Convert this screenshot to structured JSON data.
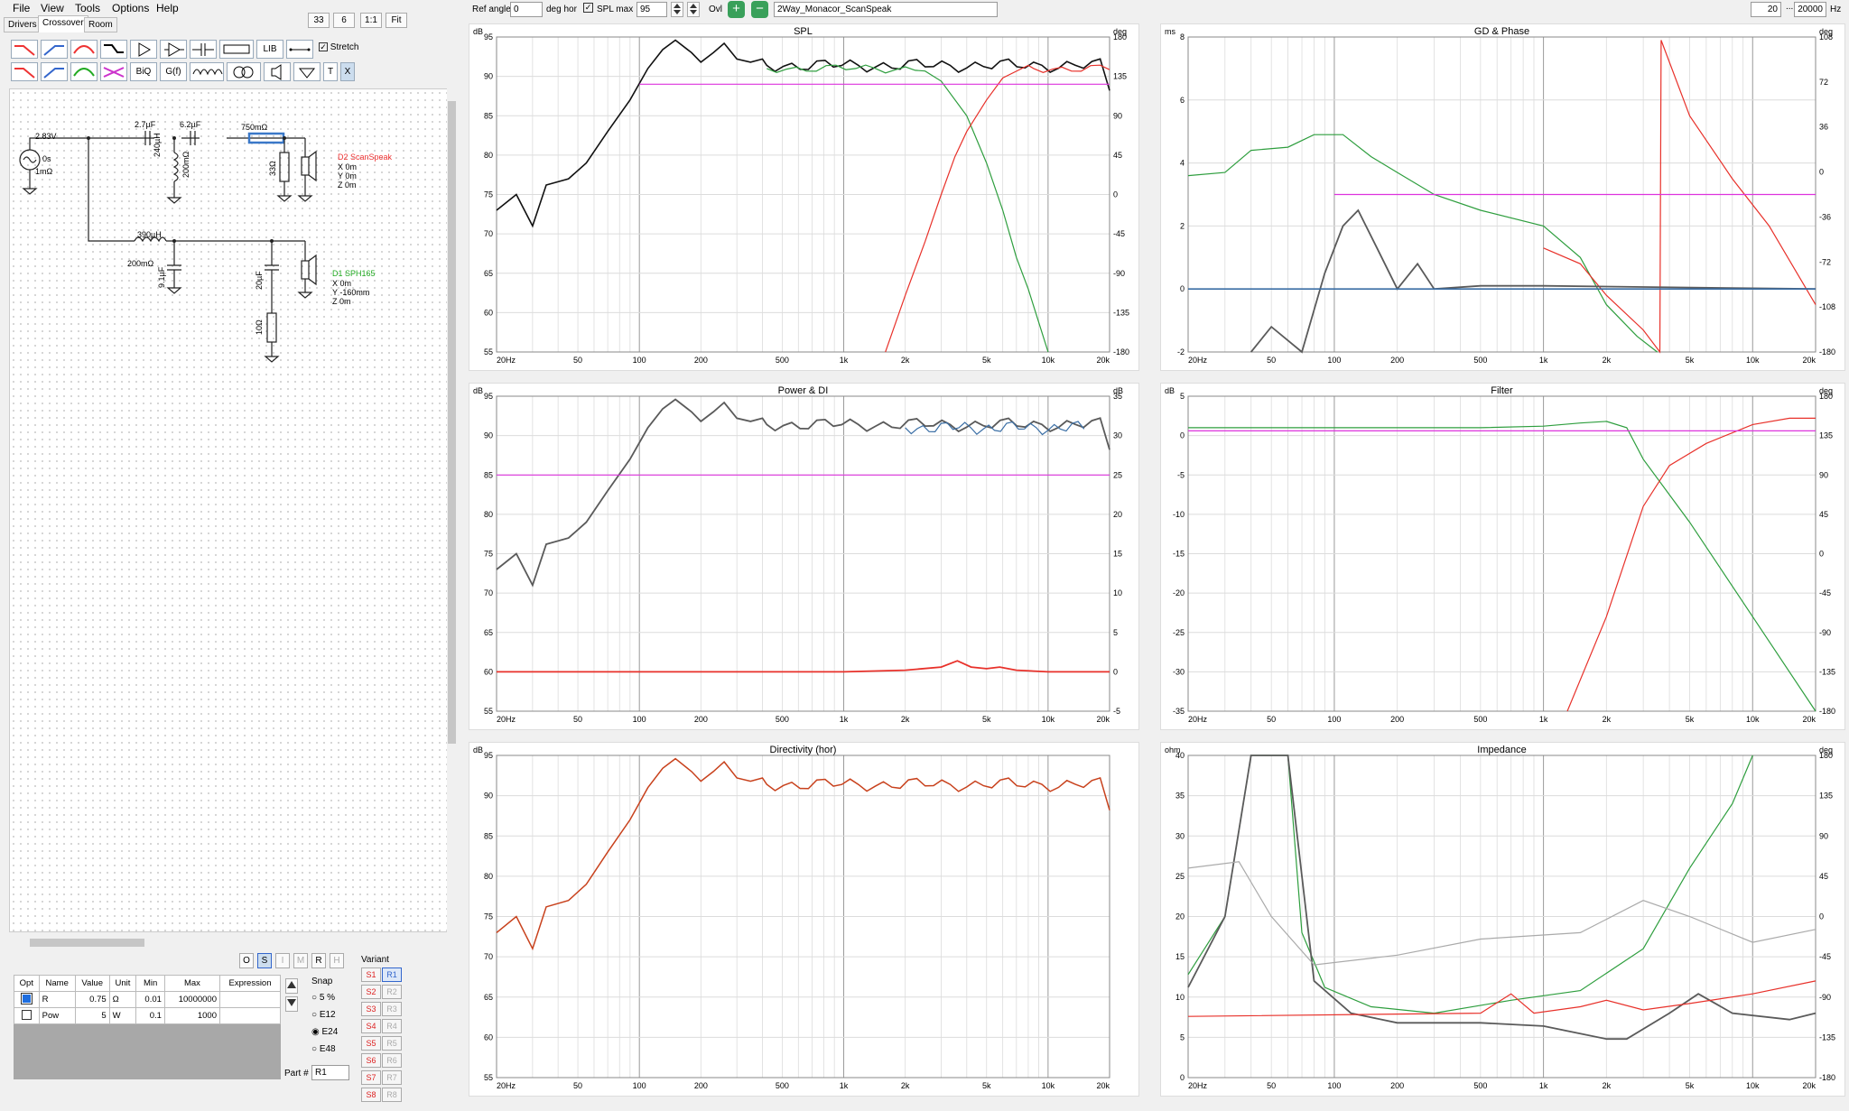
{
  "menu": [
    "File",
    "View",
    "Tools",
    "Options",
    "Help"
  ],
  "tabs": [
    "Drivers",
    "Crossover",
    "Room"
  ],
  "zoom": {
    "a": "33",
    "b": "6",
    "one": "1:1",
    "fit": "Fit"
  },
  "tools_row1": [
    "LIB"
  ],
  "tools_row2": [
    "BiQ",
    "G(f)",
    "T",
    "X"
  ],
  "stretch": "Stretch",
  "toolbar": {
    "ref_angle_label": "Ref angle",
    "ref_angle": "0",
    "deg_hor": "deg hor",
    "spl_max_label": "SPL max",
    "spl_max": "95",
    "ovl": "Ovl",
    "project": "2Way_Monacor_ScanSpeak",
    "f_min": "20",
    "f_max": "20000",
    "hz": "Hz"
  },
  "schematic": {
    "source": "2.83V",
    "src_delay": "0s",
    "src_r": "1mΩ",
    "c1": "2.7µF",
    "c2": "6.2µF",
    "r1": "750mΩ",
    "l1": "240µH",
    "l1r": "200mΩ",
    "r2": "33Ω",
    "d2": "D2 ScanSpeak",
    "d2x": "X 0m",
    "d2y": "Y 0m",
    "d2z": "Z 0m",
    "l2": "390µH",
    "l2r": "200mΩ",
    "c3": "9.1µF",
    "c4": "20µF",
    "r3": "10Ω",
    "d1": "D1 SPH165",
    "d1x": "X 0m",
    "d1y": "Y -160mm",
    "d1z": "Z 0m"
  },
  "modes": [
    "O",
    "S",
    "I",
    "M",
    "R",
    "H"
  ],
  "props": {
    "headers": [
      "Opt",
      "Name",
      "Value",
      "Unit",
      "Min",
      "Max",
      "Expression"
    ],
    "rows": [
      [
        "",
        "R",
        "0.75",
        "Ω",
        "0.01",
        "10000000",
        ""
      ],
      [
        "",
        "Pow",
        "5",
        "W",
        "0.1",
        "1000",
        ""
      ]
    ]
  },
  "snap": {
    "label": "Snap",
    "options": [
      "5 %",
      "E12",
      "E24",
      "E48"
    ],
    "selected": "E24"
  },
  "part": {
    "label": "Part #",
    "value": "R1"
  },
  "variant": {
    "label": "Variant",
    "s": [
      "S1",
      "S2",
      "S3",
      "S4",
      "S5",
      "S6",
      "S7",
      "S8"
    ],
    "r": [
      "R1",
      "R2",
      "R3",
      "R4",
      "R5",
      "R6",
      "R7",
      "R8"
    ]
  },
  "xticks": [
    "20Hz",
    "50",
    "100",
    "200",
    "500",
    "1k",
    "2k",
    "5k",
    "10k",
    "20k"
  ],
  "panels": {
    "spl": {
      "title": "SPL",
      "lu": "dB",
      "ru": "deg",
      "l": [
        "95",
        "90",
        "85",
        "80",
        "75",
        "70",
        "65",
        "60",
        "55"
      ],
      "r": [
        "180",
        "135",
        "90",
        "45",
        "0",
        "-45",
        "-90",
        "-135",
        "-180"
      ]
    },
    "gd": {
      "title": "GD & Phase",
      "lu": "ms",
      "ru": "deg",
      "l": [
        "8",
        "6",
        "4",
        "2",
        "0",
        "-2"
      ],
      "r": [
        "108",
        "72",
        "36",
        "0",
        "-36",
        "-72",
        "-108",
        "-180"
      ]
    },
    "pdi": {
      "title": "Power & DI",
      "lu": "dB",
      "ru": "dB",
      "l": [
        "95",
        "90",
        "85",
        "80",
        "75",
        "70",
        "65",
        "60",
        "55"
      ],
      "r": [
        "35",
        "30",
        "25",
        "20",
        "15",
        "10",
        "5",
        "0",
        "-5"
      ]
    },
    "filter": {
      "title": "Filter",
      "lu": "dB",
      "ru": "deg",
      "l": [
        "5",
        "0",
        "-5",
        "-10",
        "-15",
        "-20",
        "-25",
        "-30",
        "-35"
      ],
      "r": [
        "180",
        "135",
        "90",
        "45",
        "0",
        "-45",
        "-90",
        "-135",
        "-180"
      ]
    },
    "dir": {
      "title": "Directivity (hor)",
      "lu": "dB",
      "ru": "",
      "l": [
        "95",
        "90",
        "85",
        "80",
        "75",
        "70",
        "65",
        "60",
        "55"
      ],
      "r": []
    },
    "imp": {
      "title": "Impedance",
      "lu": "ohm",
      "ru": "deg",
      "l": [
        "40",
        "35",
        "30",
        "25",
        "20",
        "15",
        "10",
        "5",
        "0"
      ],
      "r": [
        "180",
        "135",
        "90",
        "45",
        "0",
        "-45",
        "-90",
        "-135",
        "-180"
      ]
    }
  },
  "colors": {
    "black": "#111111",
    "green": "#2e9e3e",
    "red": "#e8312a",
    "magenta": "#dd33dd",
    "blue": "#3a6ea5",
    "gray": "#5a5a5a",
    "orange": "#c8411c"
  }
}
